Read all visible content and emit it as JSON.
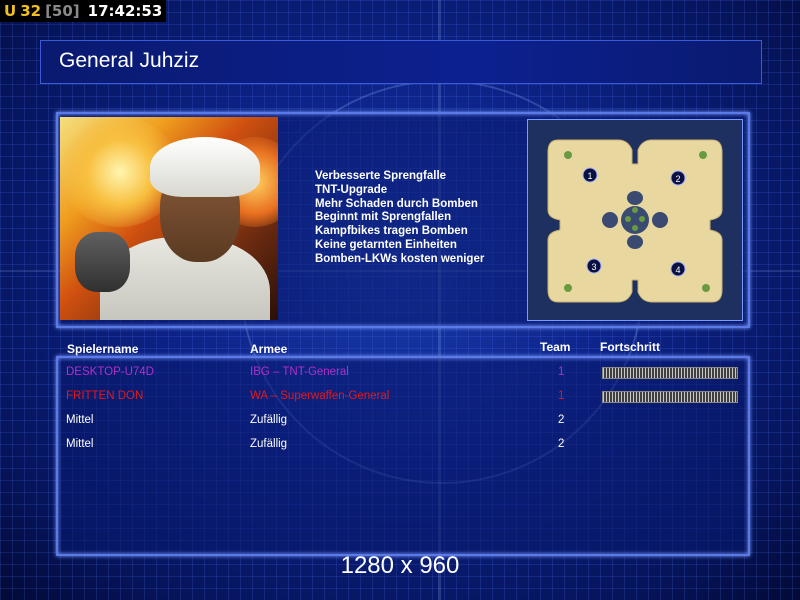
{
  "status": {
    "prefix": "U",
    "player_count": "32",
    "player_max": "[50]",
    "clock": "17:42:53"
  },
  "general": {
    "name": "General Juhziz",
    "portrait_icon": "general-juhziz-portrait",
    "traits": [
      "Verbesserte Sprengfalle",
      "TNT-Upgrade",
      "Mehr Schaden durch Bomben",
      "Beginnt mit Sprengfallen",
      "Kampfbikes tragen Bomben",
      "Keine getarnten Einheiten",
      "Bomben-LKWs kosten weniger"
    ]
  },
  "minimap": {
    "start_positions": [
      "1",
      "2",
      "3",
      "4"
    ]
  },
  "players": {
    "headers": {
      "name": "Spielername",
      "army": "Armee",
      "team": "Team",
      "progress": "Fortschritt"
    },
    "rows": [
      {
        "name": "DESKTOP-U74D",
        "army": "IBG – TNT-General",
        "team": "1",
        "color": "#b030c8",
        "progress": 1.0,
        "show_progress": true
      },
      {
        "name": "FRITTEN DON",
        "army": "WA – Superwaffen-General",
        "team": "1",
        "color": "#e81818",
        "progress": 1.0,
        "show_progress": true
      },
      {
        "name": "Mittel",
        "army": "Zufällig",
        "team": "2",
        "color": "#ffffff",
        "progress": 0,
        "show_progress": false
      },
      {
        "name": "Mittel",
        "army": "Zufällig",
        "team": "2",
        "color": "#ffffff",
        "progress": 0,
        "show_progress": false
      }
    ]
  },
  "resolution": "1280 x 960"
}
